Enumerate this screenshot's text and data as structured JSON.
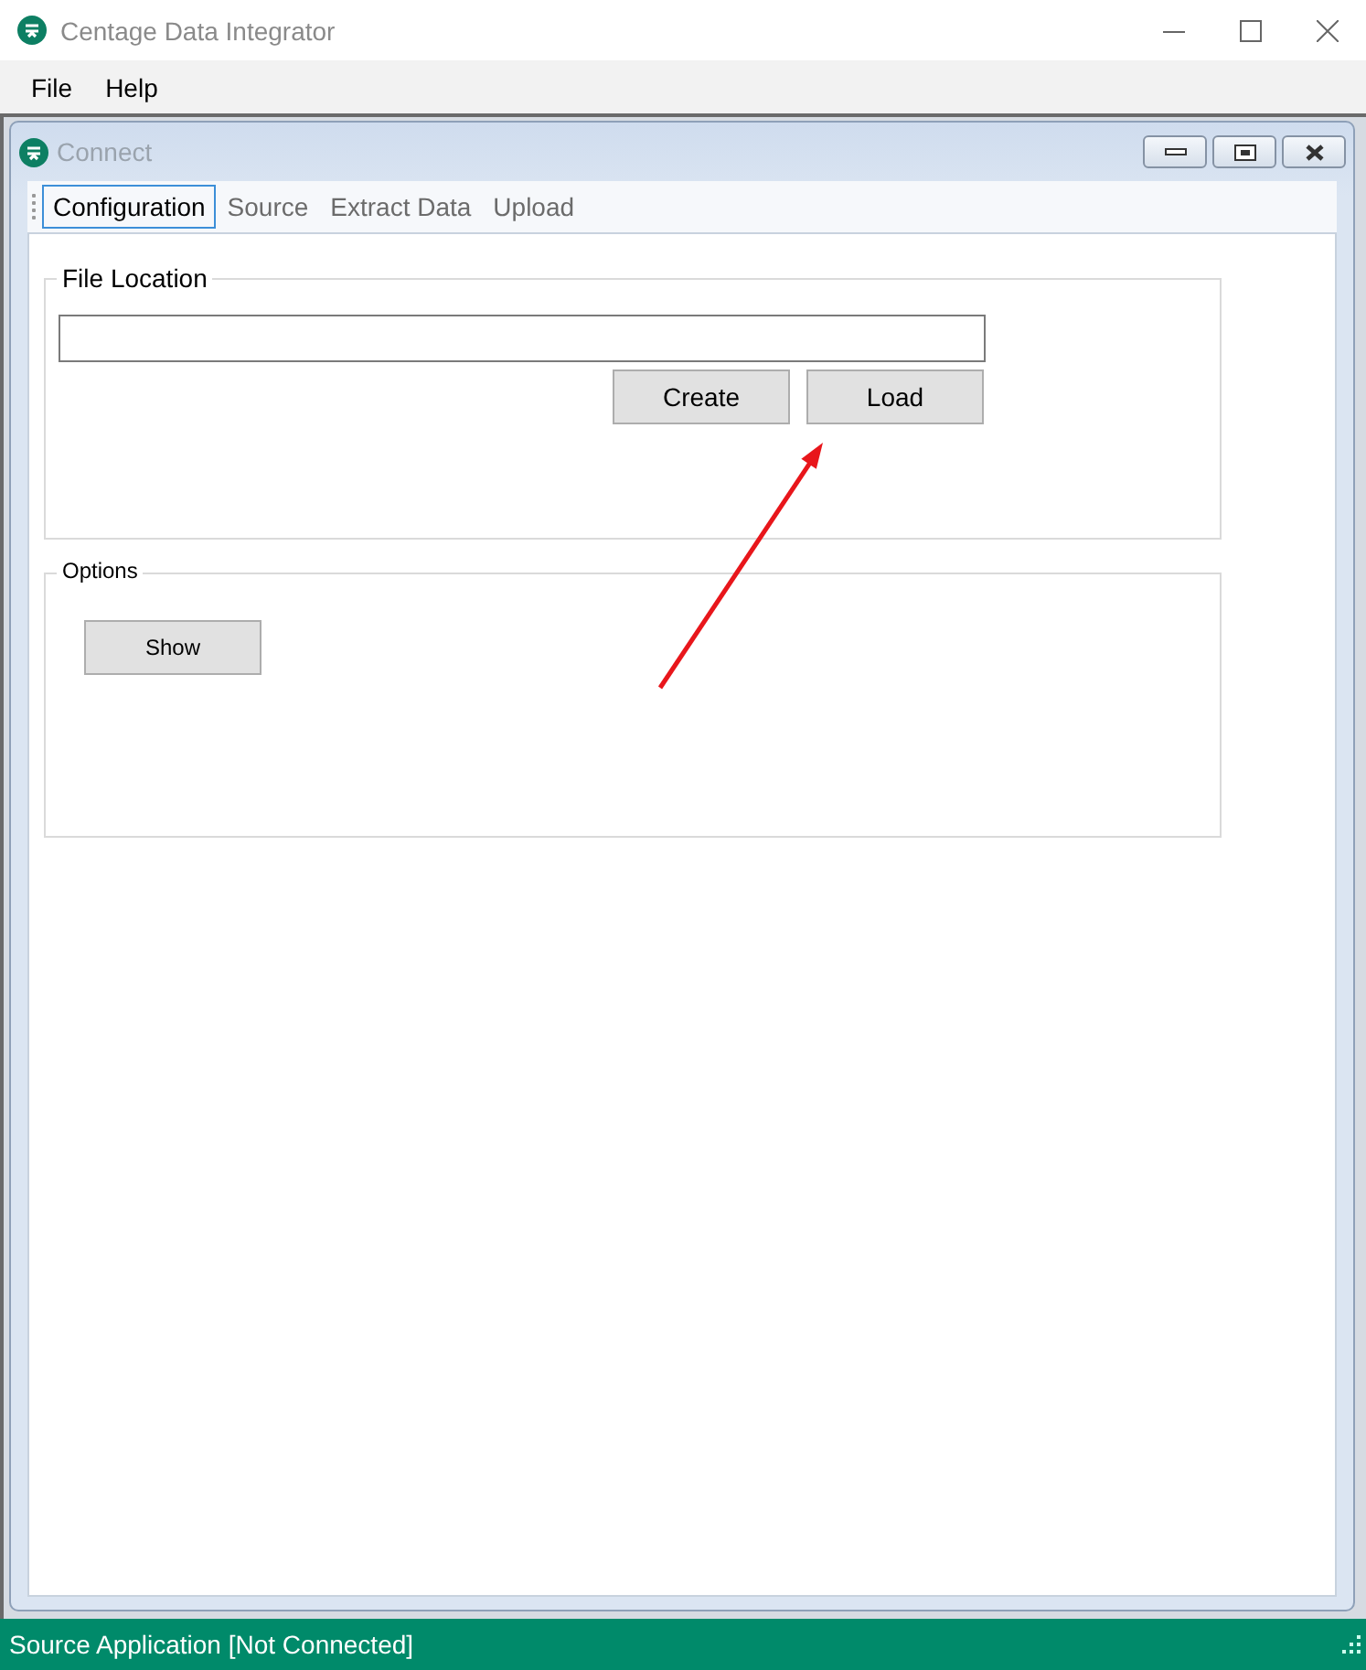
{
  "app_title": "Centage Data Integrator",
  "menu": [
    "File",
    "Help"
  ],
  "child_window": {
    "title": "Connect",
    "tabs": [
      {
        "label": "Configuration",
        "selected": true
      },
      {
        "label": "Source",
        "selected": false
      },
      {
        "label": "Extract Data",
        "selected": false
      },
      {
        "label": "Upload",
        "selected": false
      }
    ]
  },
  "file_location": {
    "label": "File Location",
    "buttons": [
      "Create",
      "Load"
    ]
  },
  "options": {
    "label": "Options",
    "buttons": [
      "Show"
    ]
  },
  "status_bar": "Source Application [Not Connected]"
}
